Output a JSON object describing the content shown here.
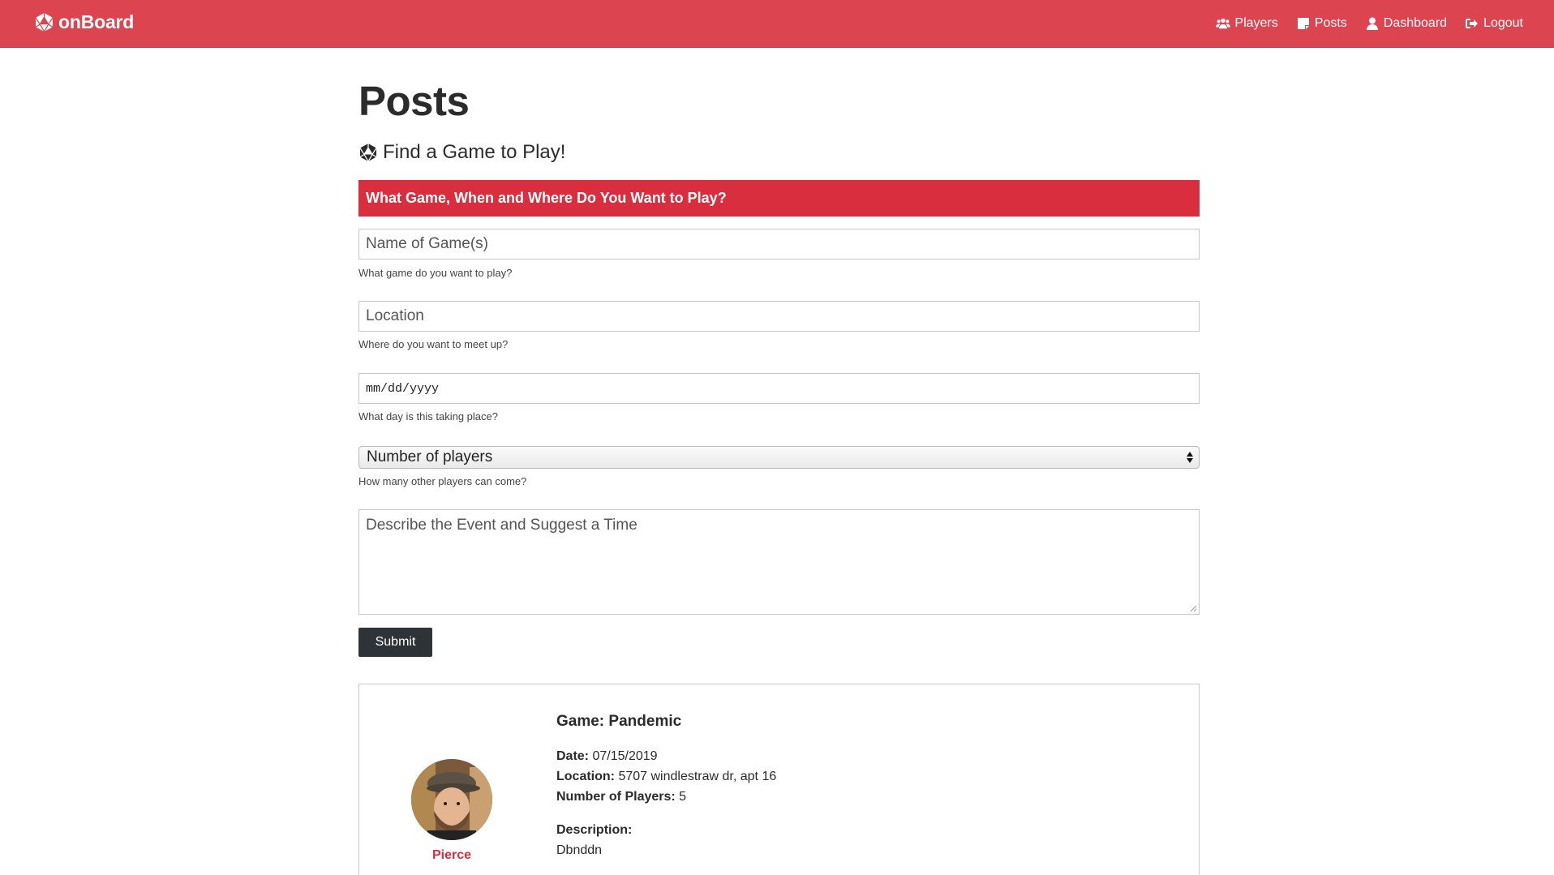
{
  "navbar": {
    "brand": "onBoard",
    "links": [
      {
        "label": "Players",
        "icon": "users-icon"
      },
      {
        "label": "Posts",
        "icon": "sticky-note-icon"
      },
      {
        "label": "Dashboard",
        "icon": "user-icon"
      },
      {
        "label": "Logout",
        "icon": "sign-out-icon"
      }
    ],
    "color": "#dc4450"
  },
  "page": {
    "title": "Posts",
    "subtitle": "Find a Game to Play!"
  },
  "form": {
    "header": "What Game, When and Where Do You Want to Play?",
    "header_color": "#d82e3e",
    "game": {
      "placeholder": "Name of Game(s)",
      "help": "What game do you want to play?"
    },
    "location": {
      "placeholder": "Location",
      "help": "Where do you want to meet up?"
    },
    "date": {
      "placeholder": "mm/dd/yyyy",
      "help": "What day is this taking place?"
    },
    "players": {
      "selected": "Number of players",
      "help": "How many other players can come?"
    },
    "description": {
      "placeholder": "Describe the Event and Suggest a Time"
    },
    "submit_label": "Submit"
  },
  "posts": [
    {
      "user": "Pierce",
      "game_label": "Game:",
      "game": "Pandemic",
      "date_label": "Date:",
      "date": "07/15/2019",
      "location_label": "Location:",
      "location": "5707 windlestraw dr, apt 16",
      "players_label": "Number of Players:",
      "players": "5",
      "description_label": "Description:",
      "description": "Dbnddn"
    }
  ]
}
